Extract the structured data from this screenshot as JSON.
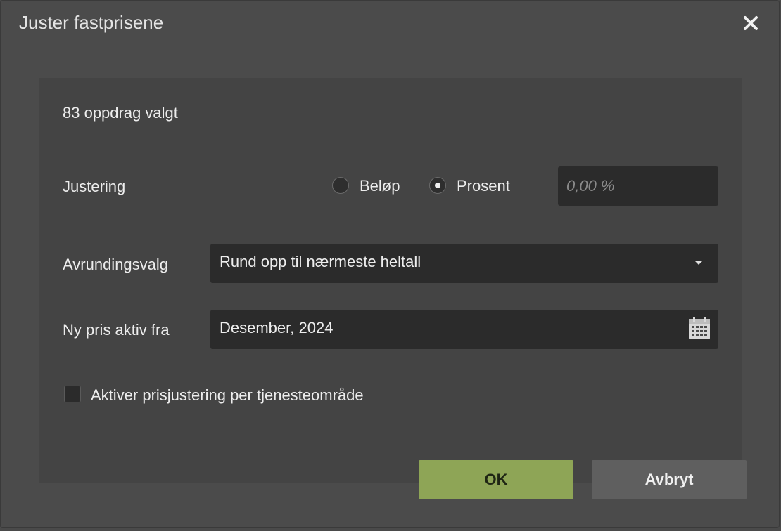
{
  "dialog": {
    "title": "Juster fastprisene",
    "close_icon": "close-icon"
  },
  "selection_text": "83 oppdrag valgt",
  "adjustment": {
    "label": "Justering",
    "options": [
      {
        "label": "Beløp",
        "checked": false
      },
      {
        "label": "Prosent",
        "checked": true
      }
    ],
    "value": "",
    "placeholder": "0,00 %"
  },
  "rounding": {
    "label": "Avrundingsvalg",
    "selected": "Rund opp til nærmeste heltall",
    "icon": "chevron-down-icon"
  },
  "active_from": {
    "label": "Ny pris aktiv fra",
    "value": "Desember, 2024",
    "icon": "calendar-icon"
  },
  "per_service_area": {
    "label": "Aktiver prisjustering per tjenesteområde",
    "checked": false
  },
  "buttons": {
    "ok": "OK",
    "cancel": "Avbryt"
  },
  "colors": {
    "ok_button": "#8ea556",
    "cancel_button": "#5f5f5f",
    "background": "#4b4b4b"
  }
}
